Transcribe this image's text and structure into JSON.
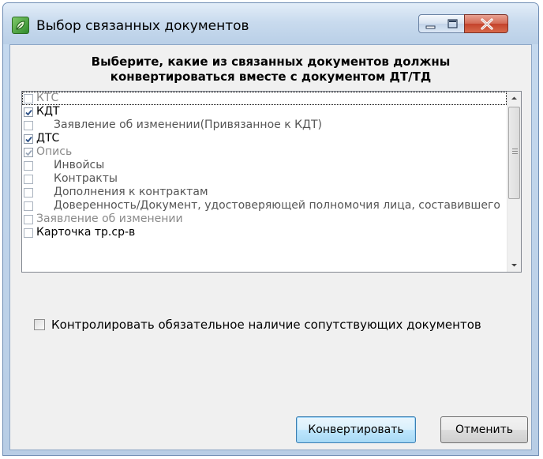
{
  "window": {
    "title": "Выбор связанных документов",
    "app_icon": "green-leaf-app-icon",
    "controls": {
      "minimize_icon": "minimize-icon",
      "maximize_icon": "maximize-icon",
      "close_icon": "close-icon"
    }
  },
  "dialog": {
    "heading_line1": "Выберите, какие из связанных документов должны",
    "heading_line2": "конвертироваться вместе с документом ДТ/ТД",
    "documents": [
      {
        "label": "КТС",
        "checked": false,
        "indent": false,
        "enabled": false,
        "focused": true
      },
      {
        "label": "КДТ",
        "checked": true,
        "indent": false,
        "enabled": true
      },
      {
        "label": "Заявление об изменении(Привязанное к КДТ)",
        "checked": false,
        "indent": true,
        "enabled": true
      },
      {
        "label": "ДТС",
        "checked": true,
        "indent": false,
        "enabled": true
      },
      {
        "label": "Опись",
        "checked": true,
        "indent": false,
        "enabled": false
      },
      {
        "label": "Инвойсы",
        "checked": false,
        "indent": true,
        "enabled": true
      },
      {
        "label": "Контракты",
        "checked": false,
        "indent": true,
        "enabled": true
      },
      {
        "label": "Дополнения к контрактам",
        "checked": false,
        "indent": true,
        "enabled": true
      },
      {
        "label": "Доверенность/Документ, удостоверяющей полномочия лица, составившего",
        "checked": false,
        "indent": true,
        "enabled": true
      },
      {
        "label": "Заявление об изменении",
        "checked": false,
        "indent": false,
        "enabled": false
      },
      {
        "label": "Карточка тр.ср-в",
        "checked": false,
        "indent": false,
        "enabled": true
      }
    ],
    "control_checkbox": {
      "label": "Контролировать обязательное наличие сопутствующих документов",
      "checked": false
    },
    "buttons": {
      "convert": "Конвертировать",
      "cancel": "Отменить"
    }
  },
  "colors": {
    "title_bar": "#c9dbee",
    "close_button": "#c3432c",
    "dialog_bg": "#f0f0f0",
    "default_button": "#bee6fd"
  }
}
